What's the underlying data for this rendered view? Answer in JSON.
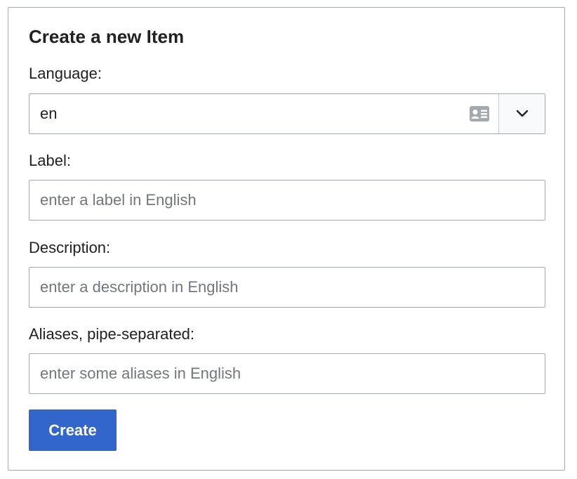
{
  "form": {
    "title": "Create a new Item",
    "language": {
      "label": "Language:",
      "value": "en",
      "icon": "id-card-icon",
      "dropdown_icon": "chevron-down-icon"
    },
    "label_field": {
      "label": "Label:",
      "value": "",
      "placeholder": "enter a label in English"
    },
    "description_field": {
      "label": "Description:",
      "value": "",
      "placeholder": "enter a description in English"
    },
    "aliases_field": {
      "label": "Aliases, pipe-separated:",
      "value": "",
      "placeholder": "enter some aliases in English"
    },
    "submit_label": "Create"
  },
  "colors": {
    "primary": "#3366cc",
    "border": "#a2a9b1",
    "text": "#202122",
    "placeholder": "#72777d",
    "icon": "#a2a9b1"
  }
}
